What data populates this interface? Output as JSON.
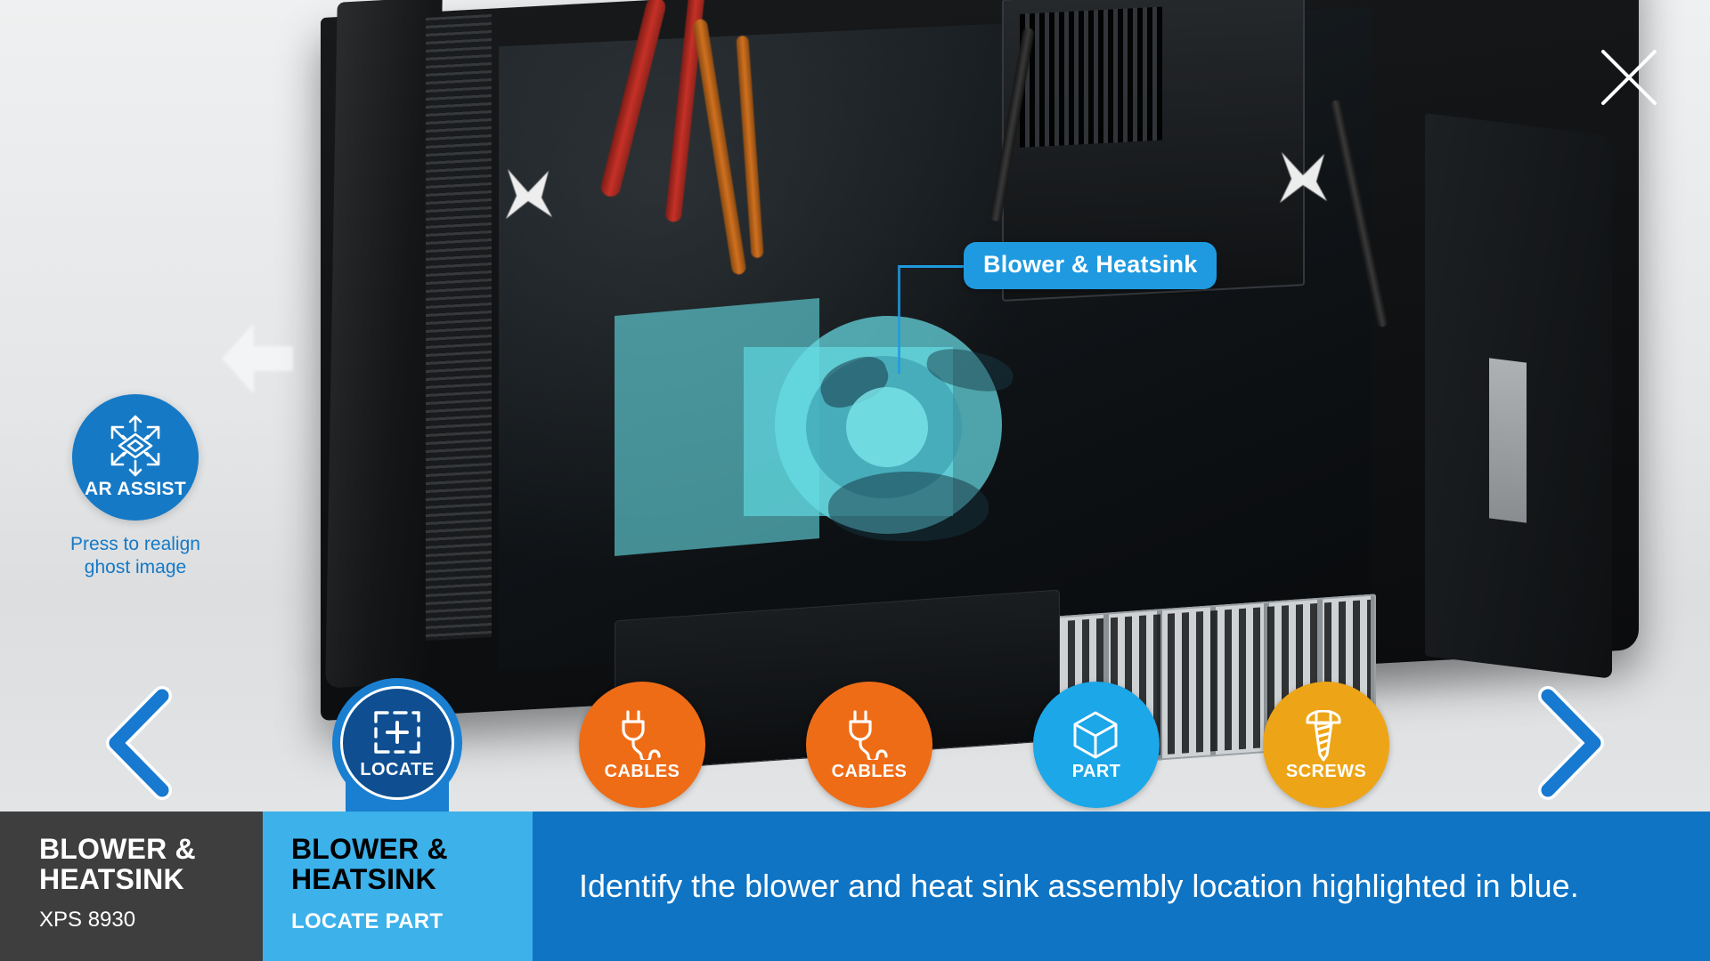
{
  "app": {
    "close_label": "close"
  },
  "ar_assist": {
    "icon": "ar-scan-icon",
    "label": "AR ASSIST",
    "hint": "Press to realign\nghost image",
    "hint_line1": "Press to realign",
    "hint_line2": "ghost image",
    "color": "#1579c6"
  },
  "scene": {
    "callout_label": "Blower & Heatsink",
    "highlight_color": "#64DAE2",
    "callout_color": "#1F9AE0",
    "alignment_marker": "x-marker",
    "ghost_arrow": "ghost-arrow-left"
  },
  "nav": {
    "prev_label": "Previous",
    "next_label": "Next",
    "arrow_color": "#1779d0"
  },
  "toolbar": {
    "steps": [
      {
        "id": "locate",
        "label": "LOCATE",
        "icon": "locate-icon",
        "color": "#1a7fd0",
        "inner_color": "#0f4f91",
        "selected": true
      },
      {
        "id": "cables1",
        "label": "CABLES",
        "icon": "cable-plug-icon",
        "color": "#ef6c16",
        "selected": false
      },
      {
        "id": "cables2",
        "label": "CABLES",
        "icon": "cable-plug-icon",
        "color": "#ef6c16",
        "selected": false
      },
      {
        "id": "part",
        "label": "PART",
        "icon": "cube-icon",
        "color": "#1ba7e8",
        "selected": false
      },
      {
        "id": "screws",
        "label": "SCREWS",
        "icon": "screw-icon",
        "color": "#eda517",
        "selected": false
      }
    ]
  },
  "bottom_bar": {
    "part": {
      "title_line1": "BLOWER &",
      "title_line2": "HEATSINK",
      "model": "XPS 8930",
      "bg": "#3e3e3e"
    },
    "step": {
      "title_line1": "BLOWER &",
      "title_line2": "HEATSINK",
      "subtitle": "LOCATE PART",
      "bg": "#3cb1ea"
    },
    "instruction": {
      "text": "Identify the blower and heat sink assembly location highlighted in blue.",
      "bg": "#0f74c4"
    }
  }
}
